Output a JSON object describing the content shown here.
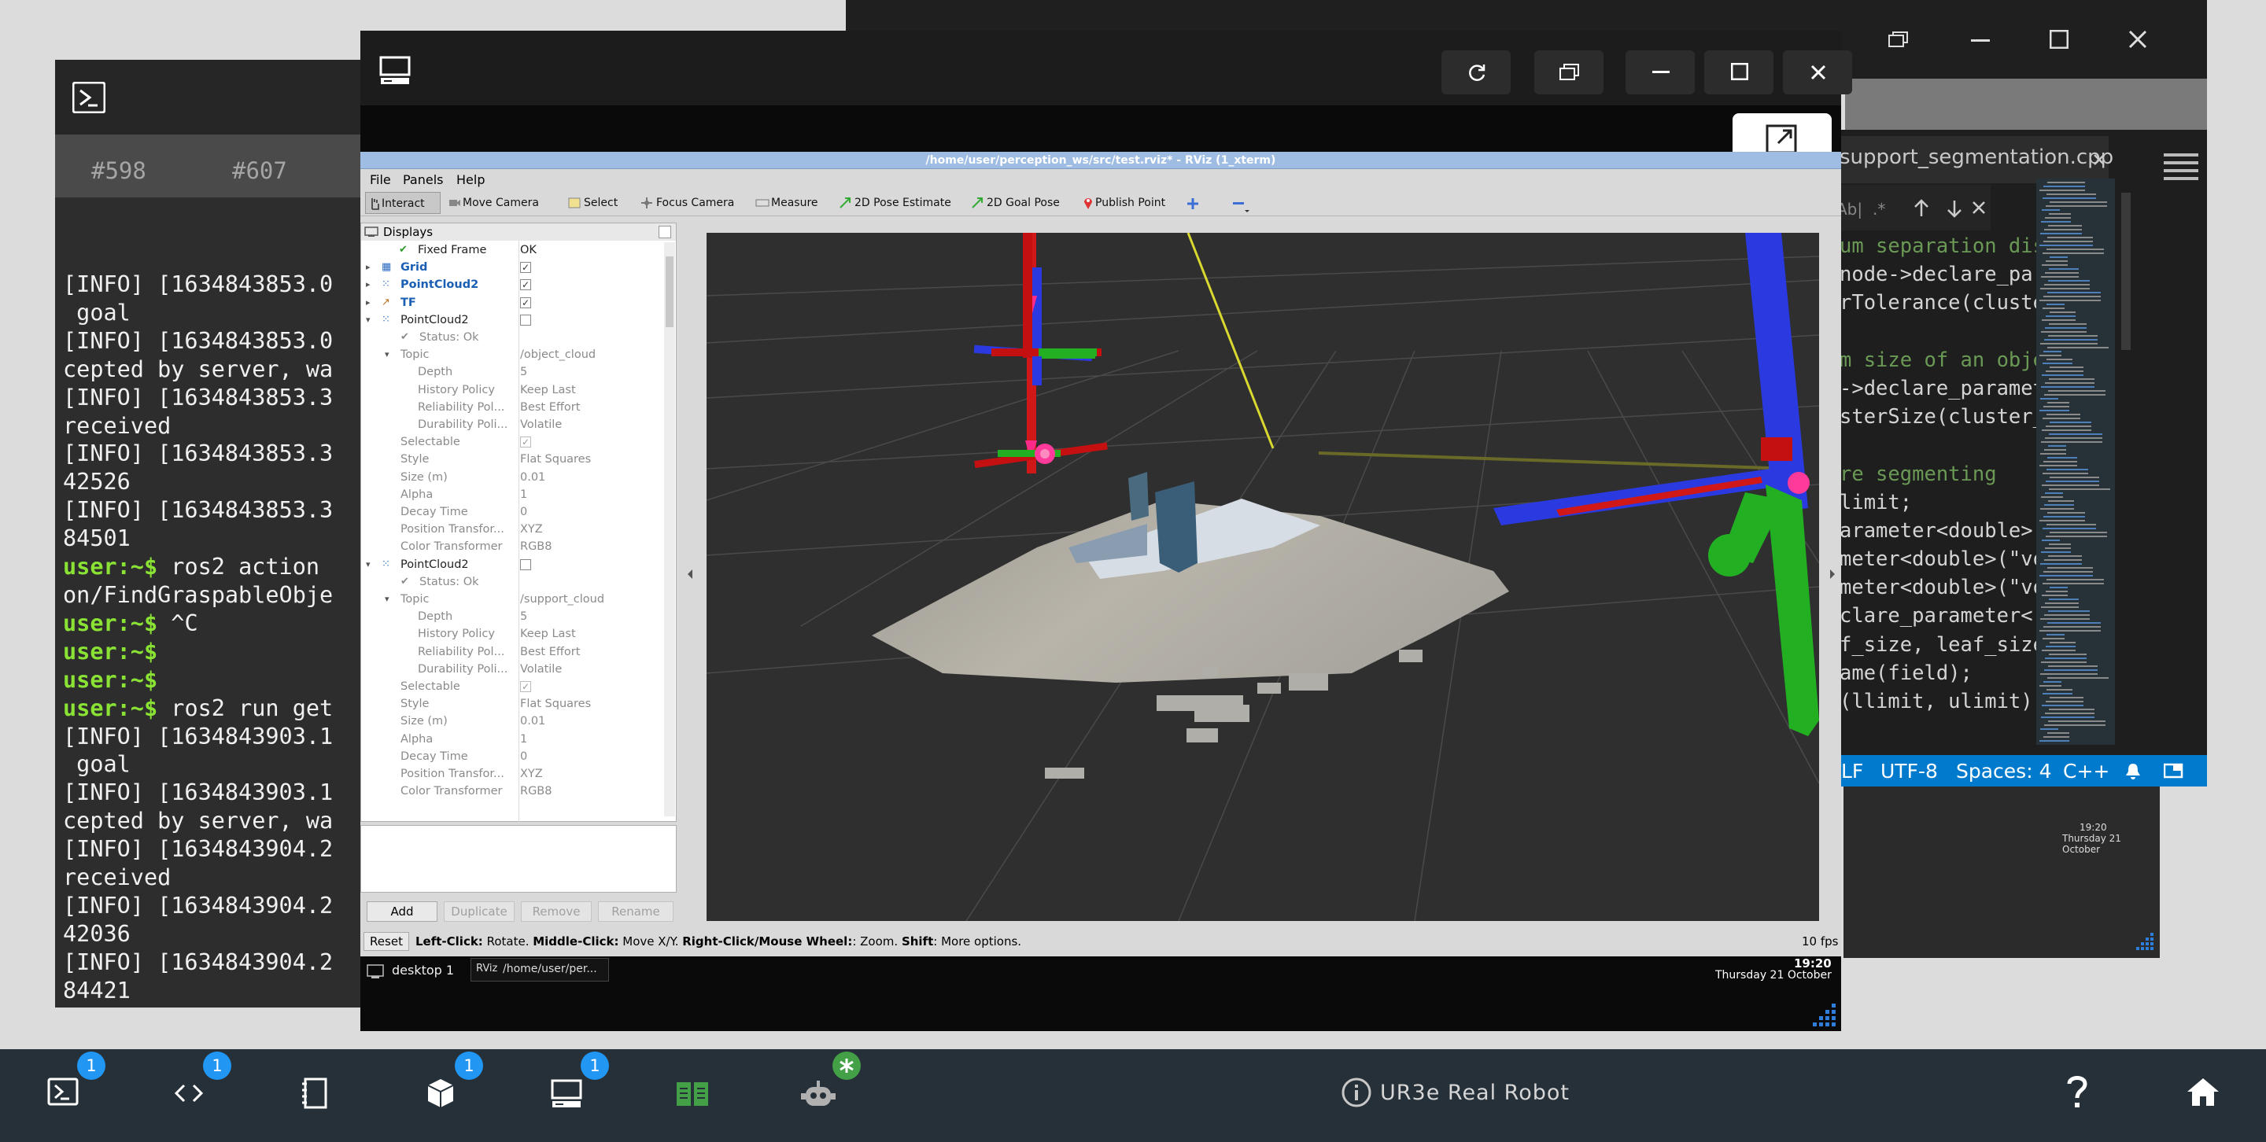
{
  "terminal": {
    "tabs": [
      "#598",
      "#607"
    ],
    "lines": [
      {
        "text": "[INFO] [1634843853.0"
      },
      {
        "text": " goal"
      },
      {
        "text": "[INFO] [1634843853.0"
      },
      {
        "text": "cepted by server, wa"
      },
      {
        "text": "[INFO] [1634843853.3"
      },
      {
        "text": "received"
      },
      {
        "text": "[INFO] [1634843853.3"
      },
      {
        "text": "42526"
      },
      {
        "text": "[INFO] [1634843853.3"
      },
      {
        "text": "84501"
      },
      {
        "prompt": "user:~$ ",
        "text": "ros2 action"
      },
      {
        "text": "on/FindGraspableObje"
      },
      {
        "prompt": "user:~$ ",
        "text": "^C"
      },
      {
        "prompt": "user:~$",
        "text": ""
      },
      {
        "prompt": "user:~$",
        "text": ""
      },
      {
        "prompt": "user:~$ ",
        "text": "ros2 run get"
      },
      {
        "text": "[INFO] [1634843903.1"
      },
      {
        "text": " goal"
      },
      {
        "text": "[INFO] [1634843903.1"
      },
      {
        "text": "cepted by server, wa"
      },
      {
        "text": "[INFO] [1634843904.2"
      },
      {
        "text": "received"
      },
      {
        "text": "[INFO] [1634843904.2"
      },
      {
        "text": "42036"
      },
      {
        "text": "[INFO] [1634843904.2"
      },
      {
        "text": "84421"
      },
      {
        "prompt": "user:~$ ",
        "text": ""
      }
    ]
  },
  "editor": {
    "tab": "support_segmentation.cpp",
    "code": [
      "um separation dis",
      "node->declare_par",
      "rTolerance(cluste",
      "",
      "m size of an obje",
      "->declare_paramete",
      "sterSize(cluster_",
      "",
      "re segmenting",
      "limit;",
      "arameter<double>(",
      "meter<double>(\"vo",
      "meter<double>(\"vo",
      "clare_parameter<",
      "f_size, leaf_size",
      "ame(field);",
      "(llimit, ulimit);"
    ],
    "status": {
      "eol": "LF",
      "encoding": "UTF-8",
      "indent": "Spaces: 4",
      "language": "C++"
    },
    "clock": {
      "time": "19:20",
      "date": "Thursday 21 October"
    }
  },
  "rviz": {
    "title": "/home/user/perception_ws/src/test.rviz* - RViz (1_xterm)",
    "menu": [
      "File",
      "Panels",
      "Help"
    ],
    "tools": [
      "Interact",
      "Move Camera",
      "Select",
      "Focus Camera",
      "Measure",
      "2D Pose Estimate",
      "2D Goal Pose",
      "Publish Point"
    ],
    "displays_title": "Displays",
    "fixed_frame": {
      "label": "Fixed Frame",
      "value": "OK"
    },
    "displays": [
      {
        "name": "Grid"
      },
      {
        "name": "PointCloud2"
      },
      {
        "name": "TF"
      }
    ],
    "pc_a": {
      "name": "PointCloud2",
      "status": "Status: Ok",
      "topic": {
        "label": "Topic",
        "value": "/object_cloud"
      },
      "props": [
        {
          "label": "Depth",
          "value": "5"
        },
        {
          "label": "History Policy",
          "value": "Keep Last"
        },
        {
          "label": "Reliability Pol...",
          "value": "Best Effort"
        },
        {
          "label": "Durability Poli...",
          "value": "Volatile"
        }
      ],
      "props2": [
        {
          "label": "Selectable",
          "value": ""
        },
        {
          "label": "Style",
          "value": "Flat Squares"
        },
        {
          "label": "Size (m)",
          "value": "0.01"
        },
        {
          "label": "Alpha",
          "value": "1"
        },
        {
          "label": "Decay Time",
          "value": "0"
        },
        {
          "label": "Position Transfor...",
          "value": "XYZ"
        },
        {
          "label": "Color Transformer",
          "value": "RGB8"
        }
      ]
    },
    "pc_b": {
      "name": "PointCloud2",
      "status": "Status: Ok",
      "topic": {
        "label": "Topic",
        "value": "/support_cloud"
      },
      "props": [
        {
          "label": "Depth",
          "value": "5"
        },
        {
          "label": "History Policy",
          "value": "Keep Last"
        },
        {
          "label": "Reliability Pol...",
          "value": "Best Effort"
        },
        {
          "label": "Durability Poli...",
          "value": "Volatile"
        }
      ],
      "props2": [
        {
          "label": "Selectable",
          "value": ""
        },
        {
          "label": "Style",
          "value": "Flat Squares"
        },
        {
          "label": "Size (m)",
          "value": "0.01"
        },
        {
          "label": "Alpha",
          "value": "1"
        },
        {
          "label": "Decay Time",
          "value": "0"
        },
        {
          "label": "Position Transfor...",
          "value": "XYZ"
        },
        {
          "label": "Color Transformer",
          "value": "RGB8"
        }
      ]
    },
    "buttons": [
      "Add",
      "Duplicate",
      "Remove",
      "Rename"
    ],
    "status": {
      "reset": "Reset",
      "hint_parts": [
        "Left-Click:",
        " Rotate. ",
        "Middle-Click:",
        " Move X/Y. ",
        "Right-Click/Mouse Wheel:",
        ": Zoom. ",
        "Shift",
        ": More options."
      ],
      "fps": "10 fps"
    }
  },
  "inner_taskbar": {
    "desktop": "desktop 1",
    "task": "/home/user/per...",
    "time": "19:20",
    "date": "Thursday 21 October"
  },
  "dock": {
    "badges": [
      "1",
      "1",
      "1",
      "1"
    ],
    "robot_label": "UR3e Real Robot",
    "colors": {
      "background": "#263038",
      "badge": "#2196f3",
      "active": "#43a047"
    }
  }
}
